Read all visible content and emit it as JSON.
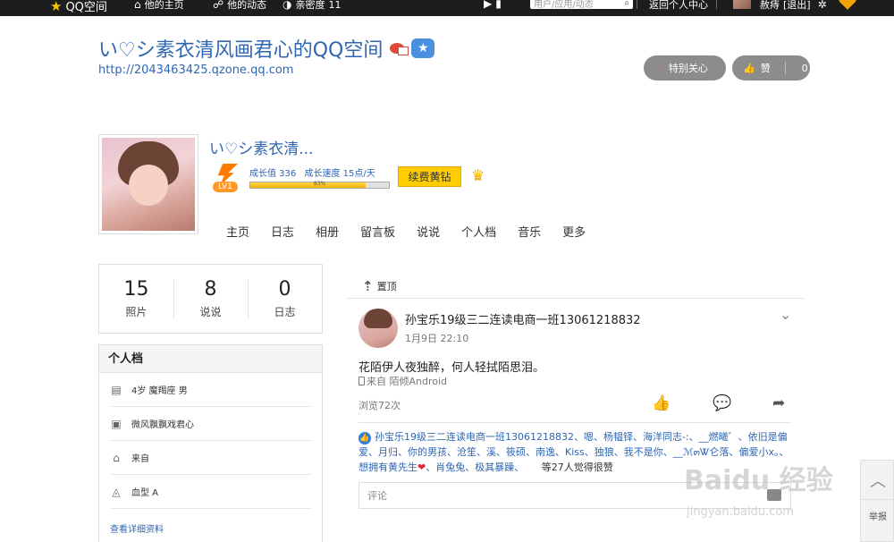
{
  "topbar": {
    "brand": "QQ空间",
    "home": "他的主页",
    "feeds": "他的动态",
    "affinity": "亲密度",
    "affinity_level": "11",
    "search_placeholder": "用户/应用/动态",
    "back_to_mine": "返回个人中心",
    "user_name": "赦痔",
    "logout": "[退出]"
  },
  "header": {
    "space_title": "い♡シ素衣清风画君心的QQ空间",
    "space_url": "http://2043463425.qzone.qq.com",
    "special_care_label": "特别关心",
    "like_label": "赞",
    "like_count": "0"
  },
  "profile": {
    "nickname": "い♡シ素衣清...",
    "level_label": "LV1",
    "growth_value": "成长值 336",
    "growth_speed": "成长速度 15点/天",
    "progress_text": "83%",
    "progress_fraction": 0.83,
    "renew_button": "续费黄钻"
  },
  "nav": {
    "tabs": [
      "主页",
      "日志",
      "相册",
      "留言板",
      "说说",
      "个人档",
      "音乐",
      "更多"
    ]
  },
  "stats": [
    {
      "num": "15",
      "label": "照片"
    },
    {
      "num": "8",
      "label": "说说"
    },
    {
      "num": "0",
      "label": "日志"
    }
  ],
  "profile_card": {
    "title": "个人档",
    "rows": [
      "4岁  魔羯座 男",
      "微风飘飘戏君心",
      "来自",
      "血型 A"
    ],
    "more": "查看详细资料"
  },
  "feed": {
    "pin_label": "置顶",
    "author": "孙宝乐19级三二连读电商一班13061218832",
    "time": "1月9日 22:10",
    "text": "花陌伊人夜独醉，何人轻拭陌思泪。",
    "source": "来自 陌倾Android",
    "views": "浏览72次",
    "likers_1": "孙宝乐19级三二连读电商一班13061218832、嗯、杨韫铎、海洋同志-:、__燃曦゛、依旧是偏爱、月归、你的男孩、沧笙、溪、筱硕、南逸、Kiss、独狼、我不是你、",
    "likers_2": "__ℳ๓Ꮤ仑落、偏爱小x。、想拥有黄先生",
    "heart": "❤",
    "likers_3": "、肖兔兔、极其暴躁、",
    "likers_tail": "等27人觉得很赞",
    "comment_placeholder": "评论"
  },
  "float": {
    "report": "举报"
  },
  "watermark": {
    "main": "Baidu 经验",
    "sub": "jingyan.baidu.com"
  }
}
